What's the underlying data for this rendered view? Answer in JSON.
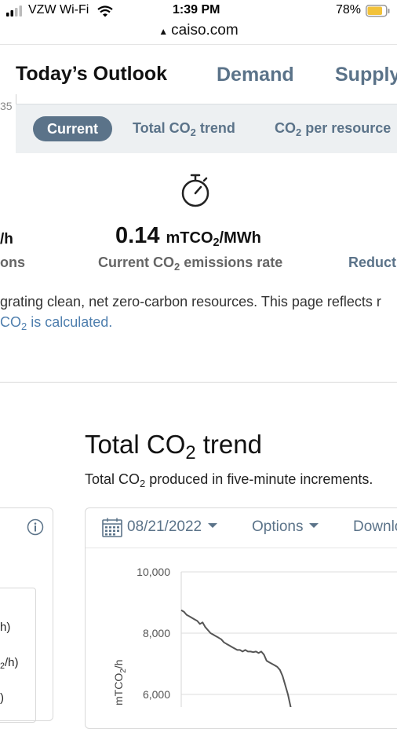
{
  "status_bar": {
    "carrier": "VZW Wi-Fi",
    "time": "1:39 PM",
    "battery": "78%"
  },
  "address_bar": {
    "url": "caiso.com"
  },
  "nav": {
    "title": "Today’s Outlook",
    "links": [
      "Demand",
      "Supply"
    ],
    "left_edge_number": "35"
  },
  "tabs": {
    "active": "Current",
    "items": [
      {
        "text": "Total CO",
        "sub": "2",
        "rest": " trend"
      },
      {
        "pre": "CO",
        "sub": "2",
        "rest": " per resource"
      }
    ]
  },
  "metric": {
    "value": "0.14",
    "unit_pre": "mTCO",
    "unit_sub": "2",
    "unit_post": "/MWh",
    "label_pre": "Current CO",
    "label_sub": "2",
    "label_post": " emissions rate",
    "left_value": "/h",
    "left_label": "ons",
    "right_label": "Reduct"
  },
  "description": {
    "line1": "grating clean, net zero-carbon resources. This page reflects r",
    "link_pre": "CO",
    "link_sub": "2",
    "link_post": " is calculated."
  },
  "section": {
    "title_pre": "Total CO",
    "title_sub": "2",
    "title_post": " trend",
    "subtitle_pre": "Total CO",
    "subtitle_sub": "2",
    "subtitle_post": " produced in five-minute increments."
  },
  "left_panel": {
    "row1": "h)",
    "row2_sub": "2",
    "row2_post": "/h)",
    "row3": ")"
  },
  "toolbar": {
    "date": "08/21/2022",
    "options": "Options",
    "download": "Downlo"
  },
  "chart_data": {
    "type": "line",
    "ylabel_pre": "mTCO",
    "ylabel_sub": "2",
    "ylabel_post": "/h",
    "ytick_labels": [
      "10,000",
      "8,000",
      "6,000"
    ],
    "ylim": [
      5000,
      10000
    ],
    "grid": true,
    "series": [
      {
        "color": "#555555",
        "x": [
          0,
          1,
          2,
          3,
          4,
          5,
          6,
          7,
          8,
          9,
          10,
          11,
          12,
          13,
          14,
          15,
          16,
          17,
          18,
          19,
          20,
          21,
          22,
          23,
          24,
          25,
          26,
          27,
          28,
          29,
          30,
          31,
          32,
          33,
          34,
          35,
          36,
          37,
          38,
          39,
          40,
          41,
          42
        ],
        "values": [
          8750,
          8700,
          8600,
          8550,
          8500,
          8450,
          8400,
          8300,
          8350,
          8200,
          8100,
          8000,
          7950,
          7900,
          7850,
          7800,
          7700,
          7650,
          7600,
          7550,
          7500,
          7450,
          7450,
          7400,
          7450,
          7400,
          7400,
          7380,
          7400,
          7350,
          7400,
          7300,
          7100,
          7050,
          7000,
          6950,
          6900,
          6800,
          6600,
          6300,
          6000,
          5600,
          5200
        ]
      }
    ]
  }
}
